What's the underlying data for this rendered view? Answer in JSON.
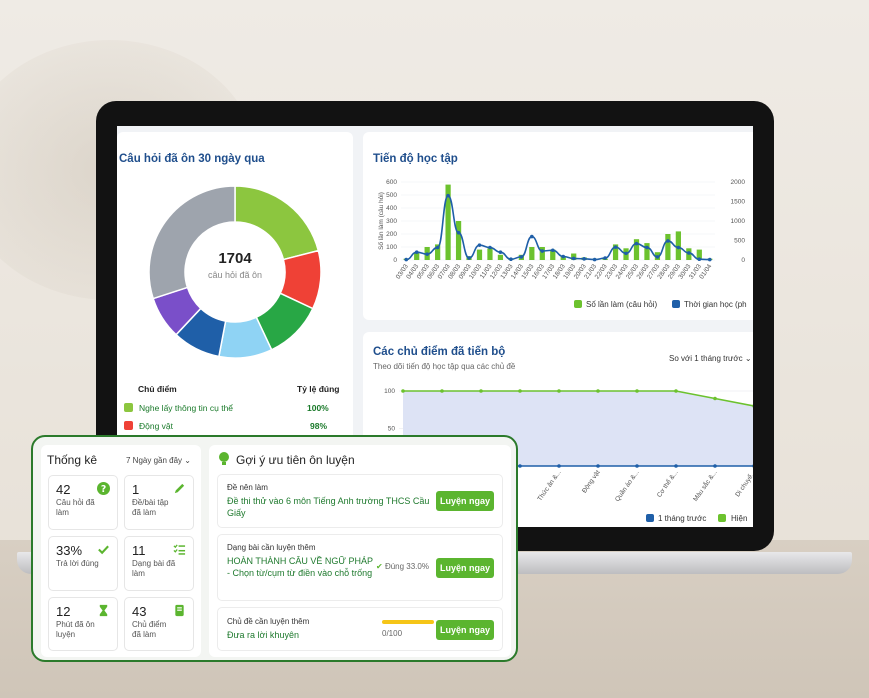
{
  "pie_card": {
    "title": "Câu hỏi đã ôn 30 ngày qua",
    "total": "1704",
    "total_label": "câu hỏi đã ôn",
    "col_topic": "Chủ điểm",
    "col_rate": "Tỷ lệ đúng",
    "rows": [
      {
        "label": "Nghe lấy thông tin cụ thể",
        "rate": "100%",
        "color": "#8cc63f"
      },
      {
        "label": "Động vật",
        "rate": "98%",
        "color": "#ef4136"
      }
    ]
  },
  "progress_card": {
    "title": "Tiến độ học tập",
    "ylabel": "Số lần làm (câu hỏi)",
    "legend_bar": "Số lần làm (câu hỏi)",
    "legend_line": "Thời gian học (ph"
  },
  "topic_card": {
    "title": "Các chủ điểm đã tiến bộ",
    "subtitle": "Theo dõi tiến độ học tập qua các chủ đề",
    "compare": "So với 1 tháng trước",
    "legend_a": "1 tháng trước",
    "legend_b": "Hiện",
    "y_ticks": [
      "100",
      "50"
    ],
    "x_labels": [
      "Thức ăn &...",
      "Động vật",
      "Quần áo &...",
      "Cơ thể &...",
      "Màu sắc &...",
      "Di chuyể..."
    ]
  },
  "chart_data": [
    {
      "type": "pie",
      "title": "Câu hỏi đã ôn 30 ngày qua",
      "slices": [
        {
          "value": 21,
          "color": "#8cc63f"
        },
        {
          "value": 11,
          "color": "#ef4136"
        },
        {
          "value": 11,
          "color": "#28a745"
        },
        {
          "value": 10,
          "color": "#8fd3f4"
        },
        {
          "value": 9,
          "color": "#1f5fa8"
        },
        {
          "value": 8,
          "color": "#7a4fc9"
        },
        {
          "value": 30,
          "color": "#9ea4ad"
        }
      ]
    },
    {
      "type": "bar",
      "title": "Tiến độ học tập",
      "categories": [
        "03/03",
        "04/03",
        "05/03",
        "06/03",
        "07/03",
        "08/03",
        "09/03",
        "10/03",
        "11/03",
        "12/03",
        "13/03",
        "14/03",
        "15/03",
        "16/03",
        "17/03",
        "18/03",
        "19/03",
        "20/03",
        "21/03",
        "22/03",
        "23/03",
        "24/03",
        "25/03",
        "26/03",
        "27/03",
        "28/03",
        "29/03",
        "30/03",
        "31/03",
        "01/04"
      ],
      "ylim": [
        0,
        600
      ],
      "y2lim": [
        0,
        2000
      ],
      "y_ticks": [
        0,
        100,
        200,
        300,
        400,
        500,
        600
      ],
      "y2_ticks": [
        0,
        500,
        1000,
        1500,
        2000
      ],
      "series": [
        {
          "name": "Số lần làm (câu hỏi)",
          "values": [
            10,
            60,
            100,
            120,
            580,
            300,
            30,
            80,
            90,
            40,
            5,
            40,
            100,
            100,
            80,
            30,
            50,
            20,
            10,
            10,
            120,
            90,
            160,
            130,
            60,
            200,
            220,
            90,
            80,
            10
          ]
        },
        {
          "name": "Thời gian học (ph",
          "values": [
            10,
            200,
            150,
            320,
            1650,
            700,
            50,
            380,
            320,
            200,
            20,
            80,
            600,
            230,
            250,
            90,
            40,
            30,
            10,
            50,
            330,
            170,
            420,
            320,
            80,
            490,
            320,
            180,
            20,
            10
          ]
        }
      ]
    },
    {
      "type": "line",
      "title": "Các chủ điểm đã tiến bộ",
      "ylim": [
        0,
        100
      ],
      "series": [
        {
          "name": "1 tháng trước",
          "values": [
            0,
            0,
            0,
            0,
            0,
            0,
            0,
            0,
            0,
            0
          ]
        },
        {
          "name": "Hiện",
          "values": [
            100,
            100,
            100,
            100,
            100,
            100,
            100,
            100,
            90,
            80
          ]
        }
      ]
    }
  ],
  "panel": {
    "stats_title": "Thống kê",
    "range": "7 Ngày gần đây",
    "stats": [
      {
        "num": "42",
        "label": "Câu hỏi đã làm",
        "icon": "question-icon"
      },
      {
        "num": "1",
        "label": "Đề/bài tập đã làm",
        "icon": "pencil-icon"
      },
      {
        "num": "33%",
        "label": "Trả lời đúng",
        "icon": "check-icon"
      },
      {
        "num": "11",
        "label": "Dạng bài đã làm",
        "icon": "checklist-icon"
      },
      {
        "num": "12",
        "label": "Phút đã ôn luyện",
        "icon": "hourglass-icon"
      },
      {
        "num": "43",
        "label": "Chủ điểm đã làm",
        "icon": "book-icon"
      }
    ],
    "sugg_title": "Gợi ý ưu tiên ôn luyện",
    "sugg": [
      {
        "kind": "Đề nên làm",
        "value": "Đề thi thử vào 6 môn Tiếng Anh trường THCS Cầu Giấy",
        "button": "Luyện ngay"
      },
      {
        "kind": "Dạng bài cần luyện thêm",
        "value": "HOÀN THÀNH CÂU VỀ NGỮ PHÁP - Chọn từ/cụm từ điền vào chỗ trống",
        "badge": "Đúng 33.0%",
        "button": "Luyện ngay"
      },
      {
        "kind": "Chủ đề cần luyện thêm",
        "value": "Đưa ra lời khuyên",
        "progress_text": "0/100",
        "button": "Luyện ngay"
      }
    ]
  }
}
